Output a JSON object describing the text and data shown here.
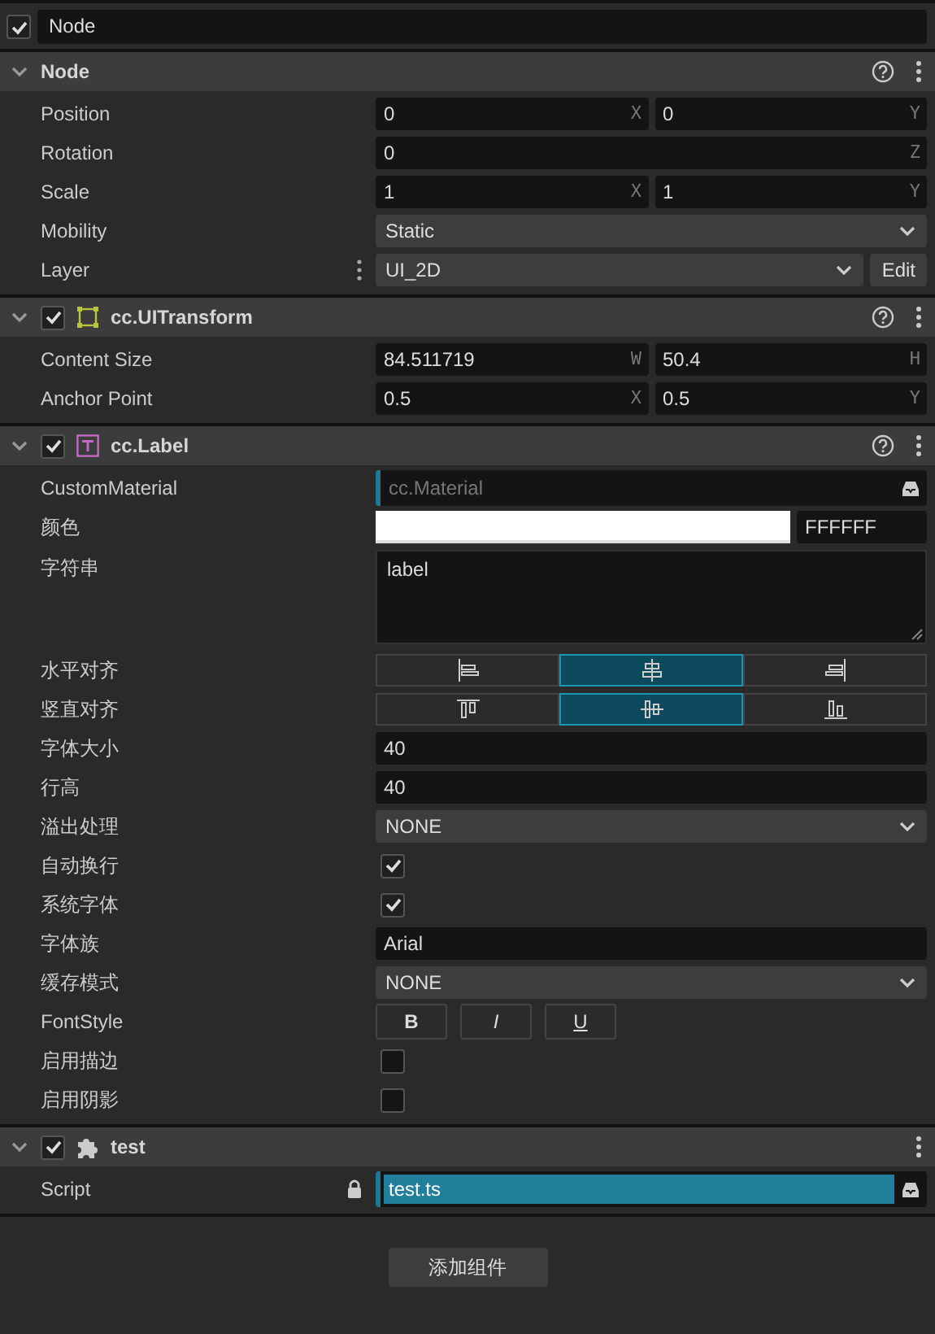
{
  "node": {
    "enabled": true,
    "name": "Node"
  },
  "components": [
    {
      "kind": "node",
      "title": "Node",
      "expanded": true,
      "properties": [
        {
          "label": "Position",
          "kind": "vec",
          "fields": [
            {
              "value": "0",
              "axis": "X"
            },
            {
              "value": "0",
              "axis": "Y"
            }
          ]
        },
        {
          "label": "Rotation",
          "kind": "vec",
          "fields": [
            {
              "value": "0",
              "axis": "Z"
            }
          ]
        },
        {
          "label": "Scale",
          "kind": "vec",
          "fields": [
            {
              "value": "1",
              "axis": "X"
            },
            {
              "value": "1",
              "axis": "Y"
            }
          ]
        },
        {
          "label": "Mobility",
          "kind": "select",
          "value": "Static"
        },
        {
          "label": "Layer",
          "kind": "layer",
          "value": "UI_2D",
          "button": "Edit"
        }
      ]
    },
    {
      "kind": "transform",
      "title": "cc.UITransform",
      "enabled": true,
      "expanded": true,
      "properties": [
        {
          "label": "Content Size",
          "kind": "vec",
          "fields": [
            {
              "value": "84.511719",
              "axis": "W"
            },
            {
              "value": "50.4",
              "axis": "H"
            }
          ]
        },
        {
          "label": "Anchor Point",
          "kind": "vec",
          "fields": [
            {
              "value": "0.5",
              "axis": "X"
            },
            {
              "value": "0.5",
              "axis": "Y"
            }
          ]
        }
      ]
    },
    {
      "kind": "label",
      "title": "cc.Label",
      "enabled": true,
      "expanded": true,
      "properties": [
        {
          "label": "CustomMaterial",
          "kind": "asset",
          "placeholder": "cc.Material"
        },
        {
          "label": "颜色",
          "kind": "color",
          "color": "#ffffff",
          "value": "FFFFFF"
        },
        {
          "label": "字符串",
          "kind": "textarea",
          "value": "label"
        },
        {
          "label": "水平对齐",
          "kind": "align",
          "options": [
            {
              "kind": "left",
              "selected": false
            },
            {
              "kind": "center",
              "selected": true
            },
            {
              "kind": "right",
              "selected": false
            }
          ]
        },
        {
          "label": "竖直对齐",
          "kind": "align",
          "options": [
            {
              "kind": "top",
              "selected": false
            },
            {
              "kind": "middle",
              "selected": true
            },
            {
              "kind": "bottom",
              "selected": false
            }
          ]
        },
        {
          "label": "字体大小",
          "kind": "text",
          "value": "40"
        },
        {
          "label": "行高",
          "kind": "text",
          "value": "40"
        },
        {
          "label": "溢出处理",
          "kind": "select",
          "value": "NONE"
        },
        {
          "label": "自动换行",
          "kind": "checkbox",
          "checked": true
        },
        {
          "label": "系统字体",
          "kind": "checkbox",
          "checked": true
        },
        {
          "label": "字体族",
          "kind": "text",
          "value": "Arial"
        },
        {
          "label": "缓存模式",
          "kind": "select",
          "value": "NONE"
        },
        {
          "label": "FontStyle",
          "kind": "fontstyle",
          "buttons": [
            {
              "label": "B",
              "kind": "bold",
              "selected": false
            },
            {
              "label": "I",
              "kind": "italic",
              "selected": false
            },
            {
              "label": "U",
              "kind": "underline",
              "selected": false
            }
          ]
        },
        {
          "label": "启用描边",
          "kind": "checkbox",
          "checked": false
        },
        {
          "label": "启用阴影",
          "kind": "checkbox",
          "checked": false
        }
      ]
    },
    {
      "kind": "script",
      "title": "test",
      "enabled": true,
      "expanded": true,
      "properties": [
        {
          "label": "Script",
          "kind": "script",
          "value": "test.ts",
          "locked": true
        }
      ]
    }
  ],
  "add_button": "添加组件"
}
